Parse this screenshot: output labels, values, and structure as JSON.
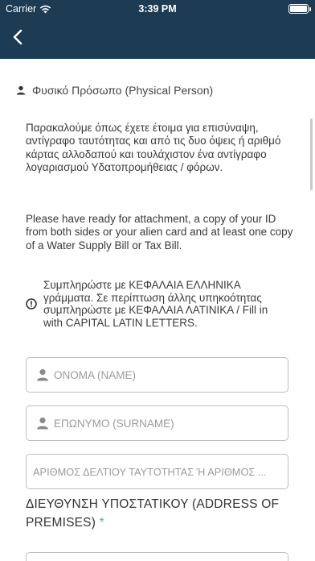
{
  "status_bar": {
    "carrier": "Carrier",
    "time": "3:39 PM"
  },
  "nav": {
    "back_icon": "chevron-left-icon",
    "bar_color": "#1d3b52"
  },
  "section": {
    "icon": "person-icon",
    "title": "Φυσικό Πρόσωπο (Physical Person)"
  },
  "instructions": {
    "greek": "Παρακαλούμε όπως έχετε έτοιμα για επισύναψη, αντίγραφο ταυτότητας και από τις δυο όψεις ή αριθμό κάρτας αλλοδαπού και τουλάχιστον ένα αντίγραφο λογαριασμού Υδατοπρομήθειας / φόρων.",
    "english": "Please have ready for attachment, a copy of your ID from both sides or your alien card and at least one copy of a Water Supply Bill or Tax Bill."
  },
  "notice": {
    "icon": "info-circle-icon",
    "text": "Συμπληρώστε με ΚΕΦΑΛΑΙΑ ΕΛΛΗΝΙΚΑ γράμματα. Σε περίπτωση άλλης υπηκοότητας συμπληρώστε με ΚΕΦΑΛΑΙΑ ΛΑΤΙΝΙΚΑ / Fill in with CAPITAL LATIN LETTERS."
  },
  "form": {
    "name_placeholder": "ΟΝΟΜΑ (NAME)",
    "surname_placeholder": "ΕΠΩΝΥΜΟ (SURNAME)",
    "id_placeholder": "ΑΡΙΘΜΟΣ ΔΕΛΤΙΟΥ ΤΑΥΤΟΤΗΤΑΣ Ή ΑΡΙΘΜΟΣ ...",
    "address_label": "ΔΙΕΥΘΥΝΣΗ ΥΠΟΣΤΑΤΙΚΟΥ (ADDRESS OF PREMISES)",
    "required_mark": "*"
  }
}
